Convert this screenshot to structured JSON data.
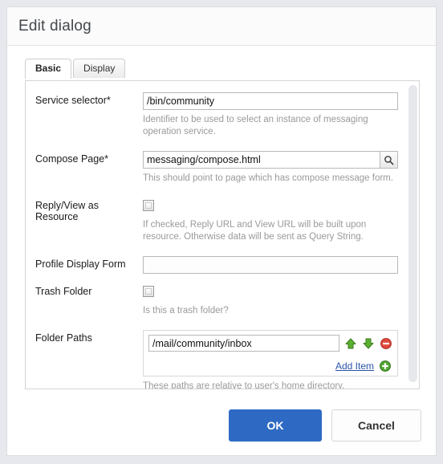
{
  "dialog": {
    "title": "Edit dialog"
  },
  "tabs": [
    {
      "label": "Basic",
      "active": true
    },
    {
      "label": "Display",
      "active": false
    }
  ],
  "form": {
    "fields": [
      {
        "label": "Service selector*",
        "value": "/bin/community",
        "help": "Identifier to be used to select an instance of messaging operation service."
      },
      {
        "label": "Compose Page*",
        "value": "messaging/compose.html",
        "help": "This should point to page which has compose message form.",
        "picker_icon": "search-icon"
      },
      {
        "label": "Reply/View as Resource",
        "checked": false,
        "help": "If checked, Reply URL and View URL will be built upon resource. Otherwise data will be sent as Query String."
      },
      {
        "label": "Profile Display Form",
        "value": "",
        "placeholder": ""
      },
      {
        "label": "Trash Folder",
        "checked": false,
        "help": "Is this a trash folder?"
      },
      {
        "label": "Folder Paths",
        "items": [
          "/mail/community/inbox"
        ],
        "add_label": "Add Item",
        "help": "These paths are relative to user's home directory."
      }
    ]
  },
  "footer": {
    "ok_label": "OK",
    "cancel_label": "Cancel"
  },
  "colors": {
    "primary": "#2e6ac4",
    "link": "#2b53a8",
    "help_text": "#9a9a9a",
    "page_background": "#e6e8ee",
    "icon_green": "#4a9e2f",
    "icon_red": "#d03b30"
  }
}
